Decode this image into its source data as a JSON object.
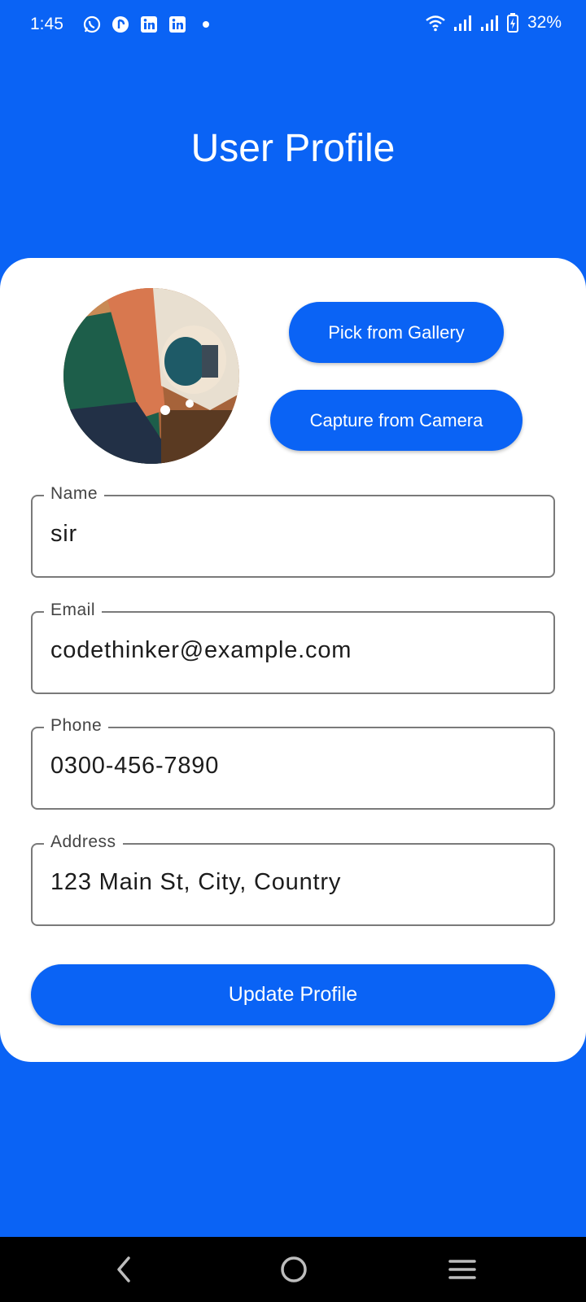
{
  "status_bar": {
    "time": "1:45",
    "notification_icons": [
      "whatsapp-icon",
      "threads-icon",
      "linkedin-icon",
      "linkedin-icon",
      "dot-icon"
    ],
    "battery_percent": "32%",
    "system_icons": [
      "wifi-icon",
      "signal-icon",
      "signal-icon",
      "battery-charging-icon"
    ]
  },
  "header": {
    "title": "User Profile"
  },
  "profile": {
    "avatar_icon": "profile-photo",
    "gallery_button": "Pick from Gallery",
    "camera_button": "Capture from Camera"
  },
  "form": {
    "name": {
      "label": "Name",
      "value": "sir"
    },
    "email": {
      "label": "Email",
      "value": "codethinker@example.com"
    },
    "phone": {
      "label": "Phone",
      "value": "0300-456-7890"
    },
    "address": {
      "label": "Address",
      "value": "123 Main St, City, Country"
    }
  },
  "actions": {
    "update_button": "Update Profile"
  },
  "nav_bar": {
    "icons": [
      "back-icon",
      "home-icon",
      "recents-icon"
    ]
  },
  "colors": {
    "primary": "#0a63f5",
    "card": "#ffffff",
    "nav": "#000000"
  }
}
